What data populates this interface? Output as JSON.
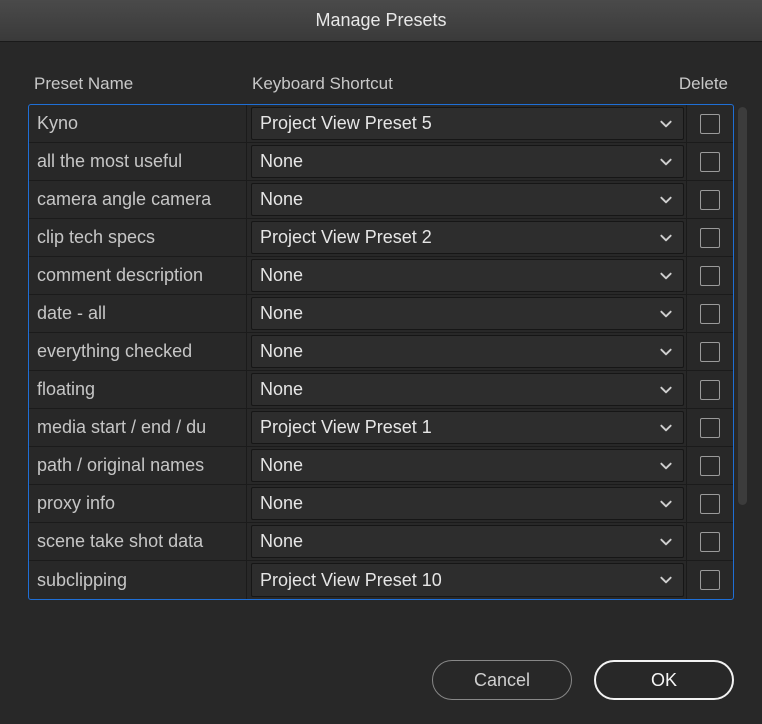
{
  "title": "Manage Presets",
  "headers": {
    "name": "Preset Name",
    "shortcut": "Keyboard Shortcut",
    "delete": "Delete"
  },
  "presets": [
    {
      "name": "Kyno",
      "shortcut": "Project View Preset 5",
      "delete": false
    },
    {
      "name": "all the most useful",
      "shortcut": "None",
      "delete": false
    },
    {
      "name": "camera angle camera",
      "shortcut": "None",
      "delete": false
    },
    {
      "name": "clip tech specs",
      "shortcut": "Project View Preset 2",
      "delete": false
    },
    {
      "name": "comment description",
      "shortcut": "None",
      "delete": false
    },
    {
      "name": "date - all",
      "shortcut": "None",
      "delete": false
    },
    {
      "name": "everything checked",
      "shortcut": "None",
      "delete": false
    },
    {
      "name": "floating",
      "shortcut": "None",
      "delete": false
    },
    {
      "name": "media start / end / du",
      "shortcut": "Project View Preset 1",
      "delete": false
    },
    {
      "name": "path / original names",
      "shortcut": "None",
      "delete": false
    },
    {
      "name": "proxy info",
      "shortcut": "None",
      "delete": false
    },
    {
      "name": "scene take shot data",
      "shortcut": "None",
      "delete": false
    },
    {
      "name": "subclipping",
      "shortcut": "Project View Preset 10",
      "delete": false
    }
  ],
  "buttons": {
    "cancel": "Cancel",
    "ok": "OK"
  }
}
